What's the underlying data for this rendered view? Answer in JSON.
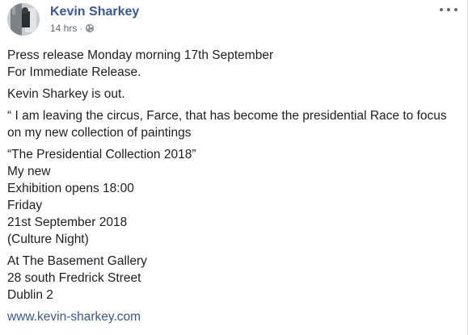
{
  "post": {
    "author": "Kevin Sharkey",
    "timestamp": "14 hrs",
    "separator": "·",
    "privacy_icon": "globe-icon",
    "more_icon": "more-options-icon",
    "paragraphs": [
      [
        "Press release Monday morning 17th September",
        "For Immediate Release."
      ],
      [
        "Kevin Sharkey is out."
      ],
      [
        "“ I am leaving the circus, Farce, that has become the presidential Race to focus on my new collection of paintings"
      ],
      [
        "“The Presidential Collection 2018”",
        "My new",
        "Exhibition opens 18:00",
        "Friday",
        "21st September 2018",
        "(Culture Night)"
      ],
      [
        "At The Basement Gallery",
        "28 south Fredrick Street",
        "Dublin 2"
      ]
    ],
    "link": "www.kevin-sharkey.com"
  },
  "colors": {
    "author": "#385898",
    "link": "#385898",
    "meta": "#616770",
    "text": "#1c1e21"
  }
}
